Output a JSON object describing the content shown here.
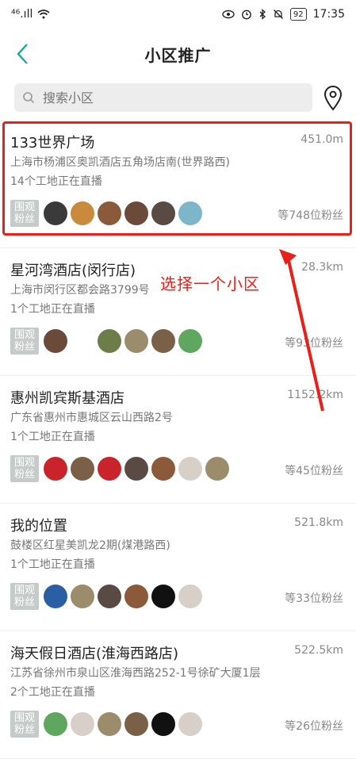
{
  "status_bar": {
    "signal": "⁴⁶.ıll",
    "battery": "92",
    "time": "17:35"
  },
  "header": {
    "title": "小区推广"
  },
  "search": {
    "placeholder": "搜索小区"
  },
  "annotation": {
    "text": "选择一个小区",
    "color": "#e8201b"
  },
  "badge_label": [
    "围观",
    "粉丝"
  ],
  "communities": [
    {
      "name": "133世界广场",
      "distance": "451.0m",
      "address": "上海市杨浦区奥凯酒店五角场店南(世界路西)",
      "live": "14个工地正在直播",
      "fans": "等748位粉丝",
      "avatars": [
        "a1",
        "a2",
        "a3",
        "a4",
        "a5",
        "a6"
      ]
    },
    {
      "name": "星河湾酒店(闵行店)",
      "distance": "28.3km",
      "address": "上海市闵行区都会路3799号",
      "live": "1个工地正在直播",
      "fans": "等93位粉丝",
      "avatars": [
        "a4",
        "gap",
        "a8",
        "a9",
        "a7",
        "a10"
      ]
    },
    {
      "name": "惠州凯宾斯基酒店",
      "distance": "1152.2km",
      "address": "广东省惠州市惠城区云山西路2号",
      "live": "1个工地正在直播",
      "fans": "等45位粉丝",
      "avatars": [
        "a12",
        "a7",
        "a12",
        "a5",
        "a3",
        "a13",
        "a9"
      ]
    },
    {
      "name": "我的位置",
      "distance": "521.8km",
      "address": "鼓楼区红星美凯龙2期(煤港路西)",
      "live": "1个工地正在直播",
      "fans": "等33位粉丝",
      "avatars": [
        "a11",
        "a9",
        "a5",
        "a3",
        "a14",
        "a13"
      ]
    },
    {
      "name": "海天假日酒店(淮海西路店)",
      "distance": "522.5km",
      "address": "江苏省徐州市泉山区淮海西路252-1号徐矿大厦1层",
      "live": "2个工地正在直播",
      "fans": "等26位粉丝",
      "avatars": [
        "a10",
        "a13",
        "a9",
        "a7",
        "a14",
        "a13"
      ]
    }
  ],
  "colors": {
    "accent": "#19a7a0",
    "highlight": "#e8201b",
    "badge": "#c5cbc9"
  }
}
